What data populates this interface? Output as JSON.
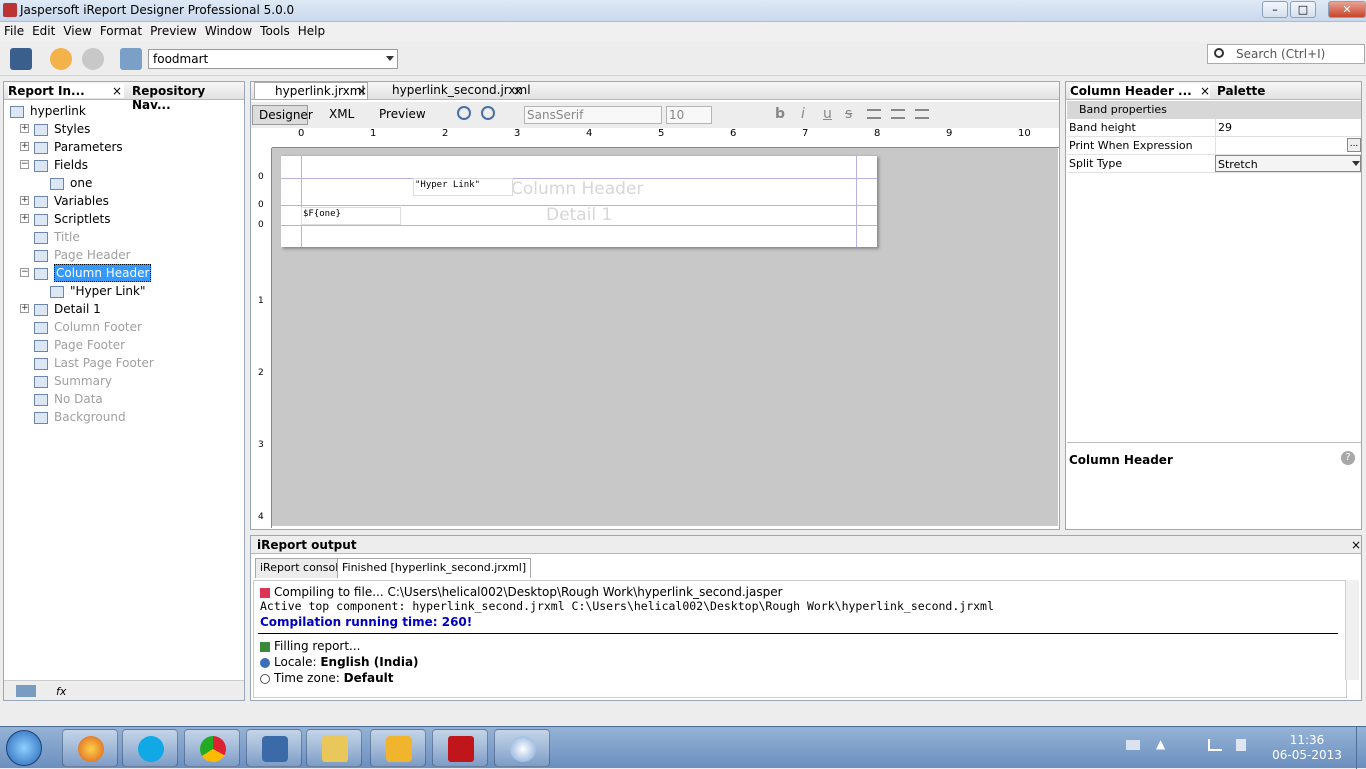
{
  "window": {
    "title": "Jaspersoft iReport Designer Professional 5.0.0",
    "controls": [
      "–",
      "□",
      "✕"
    ]
  },
  "menu": [
    "File",
    "Edit",
    "View",
    "Format",
    "Preview",
    "Window",
    "Tools",
    "Help"
  ],
  "toolbar": {
    "datasource": "foodmart",
    "search_placeholder": "Search (Ctrl+I)"
  },
  "left_panel": {
    "tabs": [
      "Report In...",
      "Repository Nav..."
    ],
    "tree": [
      {
        "label": "hyperlink",
        "icon": "report-icon",
        "indent": 0,
        "dim": false,
        "exp": ""
      },
      {
        "label": "Styles",
        "icon": "styles-icon",
        "indent": 1,
        "dim": false,
        "exp": "+"
      },
      {
        "label": "Parameters",
        "icon": "parameters-icon",
        "indent": 1,
        "dim": false,
        "exp": "+"
      },
      {
        "label": "Fields",
        "icon": "fields-icon",
        "indent": 1,
        "dim": false,
        "exp": "−"
      },
      {
        "label": "one",
        "icon": "field-icon",
        "indent": 2,
        "dim": false,
        "exp": ""
      },
      {
        "label": "Variables",
        "icon": "variables-icon",
        "indent": 1,
        "dim": false,
        "exp": "+"
      },
      {
        "label": "Scriptlets",
        "icon": "scriptlets-icon",
        "indent": 1,
        "dim": false,
        "exp": "+"
      },
      {
        "label": "Title",
        "icon": "band-icon",
        "indent": 1,
        "dim": true,
        "exp": ""
      },
      {
        "label": "Page Header",
        "icon": "band-icon",
        "indent": 1,
        "dim": true,
        "exp": ""
      },
      {
        "label": "Column Header",
        "icon": "band-icon",
        "indent": 1,
        "dim": false,
        "exp": "−",
        "selected": true
      },
      {
        "label": "\"Hyper Link\"",
        "icon": "text-icon",
        "indent": 2,
        "dim": false,
        "exp": ""
      },
      {
        "label": "Detail 1",
        "icon": "band-icon",
        "indent": 1,
        "dim": false,
        "exp": "+"
      },
      {
        "label": "Column Footer",
        "icon": "band-icon",
        "indent": 1,
        "dim": true,
        "exp": ""
      },
      {
        "label": "Page Footer",
        "icon": "band-icon",
        "indent": 1,
        "dim": true,
        "exp": ""
      },
      {
        "label": "Last Page Footer",
        "icon": "band-icon",
        "indent": 1,
        "dim": true,
        "exp": ""
      },
      {
        "label": "Summary",
        "icon": "band-icon",
        "indent": 1,
        "dim": true,
        "exp": ""
      },
      {
        "label": "No Data",
        "icon": "band-icon",
        "indent": 1,
        "dim": true,
        "exp": ""
      },
      {
        "label": "Background",
        "icon": "band-icon",
        "indent": 1,
        "dim": true,
        "exp": ""
      }
    ]
  },
  "editor": {
    "tabs": [
      "hyperlink.jrxml",
      "hyperlink_second.jrxml"
    ],
    "modes": [
      "Designer",
      "XML",
      "Preview"
    ],
    "font": "SansSerif",
    "font_size": "10",
    "ruler": [
      "0",
      "1",
      "2",
      "3",
      "4",
      "5",
      "6",
      "7",
      "8",
      "9",
      "10"
    ],
    "vruler": [
      "0",
      "0",
      "0",
      "1",
      "2",
      "3",
      "4"
    ],
    "column_header_label": "Column Header",
    "detail_label": "Detail 1",
    "hyperlink_field": "\"Hyper Link\"",
    "field_expr": "$F{one}"
  },
  "properties": {
    "tabs": [
      "Column Header ...",
      "Palette"
    ],
    "section": "Band properties",
    "rows": [
      {
        "key": "Band height",
        "value": "29"
      },
      {
        "key": "Print When Expression",
        "value": ""
      },
      {
        "key": "Split Type",
        "value": "Stretch"
      }
    ],
    "description_title": "Column Header"
  },
  "output": {
    "title": "iReport output",
    "tabs": [
      "iReport console",
      "Finished [hyperlink_second.jrxml]"
    ],
    "line1": "Compiling to file... C:\\Users\\helical002\\Desktop\\Rough Work\\hyperlink_second.jasper",
    "line2": "Active top component: hyperlink_second.jrxml C:\\Users\\helical002\\Desktop\\Rough Work\\hyperlink_second.jrxml",
    "line3": "Compilation running time: 260!",
    "line4": "Filling report...",
    "line5_label": "Locale: ",
    "line5_value": "English (India)",
    "line6_label": "Time zone: ",
    "line6_value": "Default"
  },
  "taskbar": {
    "time": "11:36",
    "date": "06-05-2013",
    "apps": [
      "start",
      "firefox",
      "skype",
      "chrome",
      "virtualbox",
      "explorer",
      "outlook",
      "acrobat",
      "paint"
    ]
  }
}
